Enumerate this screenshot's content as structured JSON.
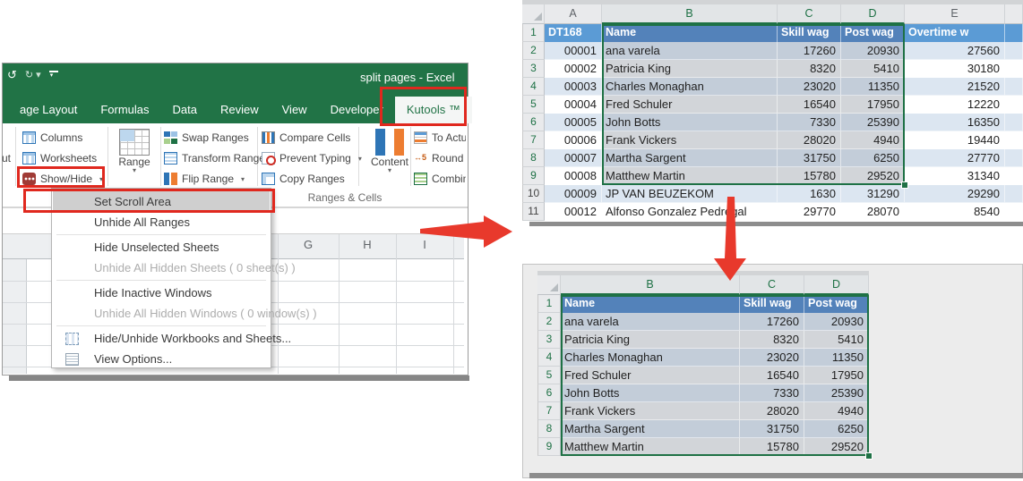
{
  "colors": {
    "excel_green": "#217346",
    "annotation_red": "#e0281e",
    "table_header_blue": "#5b9bd5",
    "table_header_blue_selected": "#5382ba",
    "band_blue": "#dce6f1",
    "band_blue_selected": "#c3cdd9",
    "white_selected": "#d2d5d9",
    "selection_green": "#1e7145"
  },
  "excel": {
    "qat_icons": [
      "undo-icon",
      "redo-icon",
      "customize-qat-icon"
    ],
    "title": "split pages - Excel",
    "tabs": [
      {
        "label": "age Layout"
      },
      {
        "label": "Formulas"
      },
      {
        "label": "Data"
      },
      {
        "label": "Review"
      },
      {
        "label": "View"
      },
      {
        "label": "Developer"
      },
      {
        "label": "Kutools ™",
        "active": true
      }
    ],
    "ribbon": {
      "cut_label": "ut",
      "group1": [
        {
          "label": "Columns",
          "icon": "columns-icon"
        },
        {
          "label": "Worksheets",
          "icon": "worksheets-icon"
        },
        {
          "label": "Show/Hide",
          "icon": "show-hide-icon",
          "caret": true
        }
      ],
      "range": {
        "label": "Range",
        "icon": "range-grid-icon",
        "caret": true
      },
      "group2": [
        {
          "label": "Swap Ranges",
          "icon": "swap-ranges-icon"
        },
        {
          "label": "Transform Range",
          "icon": "transform-range-icon"
        },
        {
          "label": "Flip Range",
          "icon": "flip-range-icon",
          "caret": true
        }
      ],
      "group3": [
        {
          "label": "Compare Cells",
          "icon": "compare-cells-icon"
        },
        {
          "label": "Prevent Typing",
          "icon": "prevent-typing-icon",
          "caret": true
        },
        {
          "label": "Copy Ranges",
          "icon": "copy-ranges-icon"
        }
      ],
      "content": {
        "label": "Content",
        "icon": "content-icon",
        "caret": true
      },
      "group4": [
        {
          "label": "To Actu",
          "icon": "to-actual-icon"
        },
        {
          "label": "Round",
          "icon": "round-icon"
        },
        {
          "label": "Combin",
          "icon": "combine-icon"
        }
      ],
      "group_name": "Ranges & Cells"
    },
    "menu": [
      {
        "label": "Set Scroll Area",
        "highlight": true
      },
      {
        "label": "Unhide All Ranges"
      },
      {
        "separator": true
      },
      {
        "label": "Hide Unselected Sheets"
      },
      {
        "label": "Unhide All Hidden Sheets ( 0 sheet(s) )",
        "disabled": true
      },
      {
        "separator": true
      },
      {
        "label": "Hide Inactive Windows"
      },
      {
        "label": "Unhide All Hidden Windows ( 0 window(s) )",
        "disabled": true
      },
      {
        "separator": true
      },
      {
        "label": "Hide/Unhide Workbooks and Sheets...",
        "icon": "workbooks-sheets-icon"
      },
      {
        "label": "View Options...",
        "icon": "view-options-icon"
      }
    ],
    "sheet_columns": [
      "G",
      "H",
      "I"
    ]
  },
  "top_table": {
    "column_letters": [
      "A",
      "B",
      "C",
      "D",
      "E"
    ],
    "selected_letters": [
      "B",
      "C",
      "D"
    ],
    "headers": [
      "DT168",
      "Name",
      "Skill wag",
      "Post wag",
      "Overtime w"
    ],
    "row_numbers": [
      "1",
      "2",
      "3",
      "4",
      "5",
      "6",
      "7",
      "8",
      "9",
      "10",
      "11"
    ],
    "rows": [
      [
        "00001",
        "ana varela",
        "17260",
        "20930",
        "27560"
      ],
      [
        "00002",
        "Patricia King",
        "8320",
        "5410",
        "30180"
      ],
      [
        "00003",
        "Charles Monaghan",
        "23020",
        "11350",
        "21520"
      ],
      [
        "00004",
        "Fred Schuler",
        "16540",
        "17950",
        "12220"
      ],
      [
        "00005",
        "John Botts",
        "7330",
        "25390",
        "16350"
      ],
      [
        "00006",
        "Frank Vickers",
        "28020",
        "4940",
        "19440"
      ],
      [
        "00007",
        "Martha Sargent",
        "31750",
        "6250",
        "27770"
      ],
      [
        "00008",
        "Matthew Martin",
        "15780",
        "29520",
        "31340"
      ],
      [
        "00009",
        "JP VAN BEUZEKOM",
        "1630",
        "31290",
        "29290"
      ],
      [
        "00012",
        "Alfonso Gonzalez Pedregal",
        "29770",
        "28070",
        "8540"
      ]
    ]
  },
  "bottom_table": {
    "column_letters": [
      "B",
      "C",
      "D"
    ],
    "headers": [
      "Name",
      "Skill wag",
      "Post wag"
    ],
    "row_numbers": [
      "1",
      "2",
      "3",
      "4",
      "5",
      "6",
      "7",
      "8",
      "9"
    ],
    "rows": [
      [
        "ana varela",
        "17260",
        "20930"
      ],
      [
        "Patricia King",
        "8320",
        "5410"
      ],
      [
        "Charles Monaghan",
        "23020",
        "11350"
      ],
      [
        "Fred Schuler",
        "16540",
        "17950"
      ],
      [
        "John Botts",
        "7330",
        "25390"
      ],
      [
        "Frank Vickers",
        "28020",
        "4940"
      ],
      [
        "Martha Sargent",
        "31750",
        "6250"
      ],
      [
        "Matthew Martin",
        "15780",
        "29520"
      ]
    ]
  },
  "annotations": {
    "boxes": [
      "kutools-tab-box",
      "show-hide-button-box",
      "set-scroll-area-box"
    ],
    "arrows": [
      "arrow-right-to-top-table",
      "arrow-down-to-bottom-table"
    ]
  }
}
